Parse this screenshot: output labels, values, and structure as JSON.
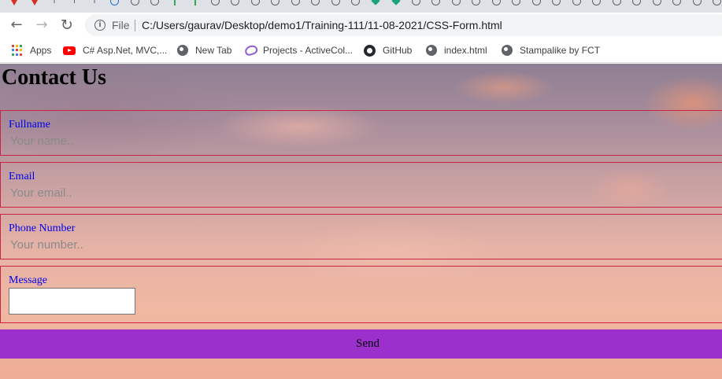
{
  "browser": {
    "address_bar": {
      "security_label": "File",
      "url": "C:/Users/gaurav/Desktop/demo1/Training-111/11-08-2021/CSS-Form.html"
    },
    "bookmarks": [
      {
        "label": "Apps",
        "icon": "apps-grid-icon"
      },
      {
        "label": "C# Asp.Net, MVC,...",
        "icon": "youtube-icon"
      },
      {
        "label": "New Tab",
        "icon": "globe-icon"
      },
      {
        "label": "Projects - ActiveCol...",
        "icon": "activecollab-icon"
      },
      {
        "label": "GitHub",
        "icon": "github-icon"
      },
      {
        "label": "index.html",
        "icon": "globe-icon"
      },
      {
        "label": "Stampalike by FCT",
        "icon": "globe-icon"
      }
    ]
  },
  "page": {
    "title": "Contact Us",
    "form": {
      "fullname": {
        "label": "Fullname",
        "placeholder": "Your name.."
      },
      "email": {
        "label": "Email",
        "placeholder": "Your email.."
      },
      "phone": {
        "label": "Phone Number",
        "placeholder": "Your number.."
      },
      "message": {
        "label": "Message",
        "value": ""
      },
      "submit_label": "Send"
    }
  },
  "colors": {
    "field_border": "#cc2244",
    "label_text": "#0000ee",
    "send_button_bg": "#9b30cd",
    "page_background": "sunset sky (mauve to peach)"
  }
}
